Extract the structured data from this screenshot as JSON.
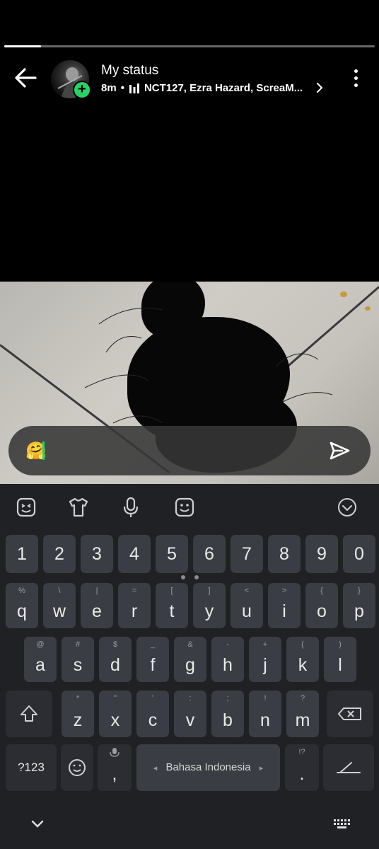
{
  "status": {
    "title": "My status",
    "time": "8m",
    "separator": "•",
    "music_icon": "music-bars-icon",
    "music_text": "NCT127, Ezra Hazard, ScreaM...",
    "progress": 0.1
  },
  "caption": {
    "emoji": "🤗"
  },
  "keyboard": {
    "number_row": [
      "1",
      "2",
      "3",
      "4",
      "5",
      "6",
      "7",
      "8",
      "9",
      "0"
    ],
    "row1": [
      {
        "main": "q",
        "sub": "%"
      },
      {
        "main": "w",
        "sub": "\\"
      },
      {
        "main": "e",
        "sub": "|"
      },
      {
        "main": "r",
        "sub": "="
      },
      {
        "main": "t",
        "sub": "["
      },
      {
        "main": "y",
        "sub": "]"
      },
      {
        "main": "u",
        "sub": "<"
      },
      {
        "main": "i",
        "sub": ">"
      },
      {
        "main": "o",
        "sub": "{"
      },
      {
        "main": "p",
        "sub": "}"
      }
    ],
    "row2": [
      {
        "main": "a",
        "sub": "@"
      },
      {
        "main": "s",
        "sub": "#"
      },
      {
        "main": "d",
        "sub": "$"
      },
      {
        "main": "f",
        "sub": "_"
      },
      {
        "main": "g",
        "sub": "&"
      },
      {
        "main": "h",
        "sub": "-"
      },
      {
        "main": "j",
        "sub": "+"
      },
      {
        "main": "k",
        "sub": "("
      },
      {
        "main": "l",
        "sub": ")"
      }
    ],
    "row3": [
      {
        "main": "z",
        "sub": "*"
      },
      {
        "main": "x",
        "sub": "\""
      },
      {
        "main": "c",
        "sub": "'"
      },
      {
        "main": "v",
        "sub": ":"
      },
      {
        "main": "b",
        "sub": ";"
      },
      {
        "main": "n",
        "sub": "!"
      },
      {
        "main": "m",
        "sub": "?"
      }
    ],
    "symbols_label": "?123",
    "comma_label": ",",
    "space_label": "Bahasa Indonesia",
    "space_left_arrow": "◂",
    "space_right_arrow": "▸",
    "period_label": ".",
    "period_sub": "!?"
  },
  "colors": {
    "accent": "#25d366",
    "keyboard_bg": "#1f2125",
    "key_bg": "#3a3d43"
  }
}
